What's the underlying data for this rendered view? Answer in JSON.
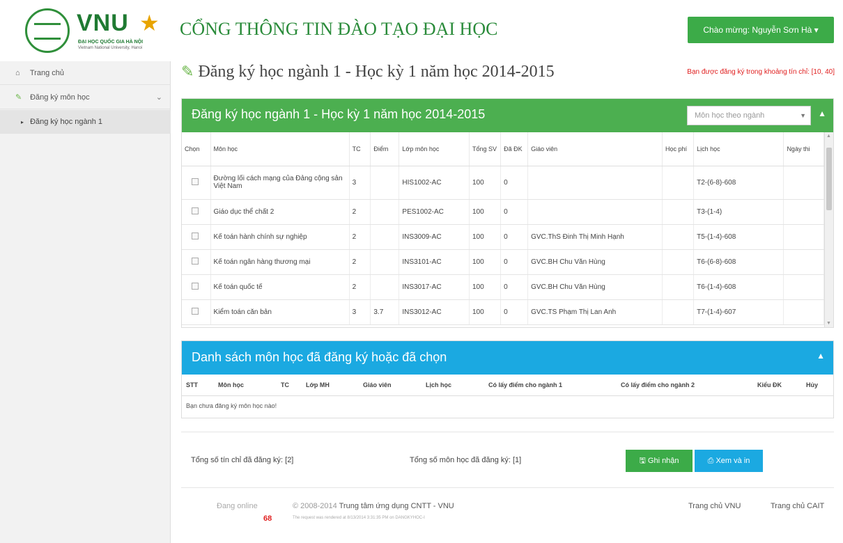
{
  "header": {
    "logo_text": "VNU",
    "logo_sub1": "ĐẠI HỌC QUỐC GIA HÀ NỘI",
    "logo_sub2": "Vietnam National University, Hanoi",
    "site_title": "CỔNG THÔNG TIN ĐÀO TẠO ĐẠI HỌC",
    "user_menu": "Chào mừng: Nguyễn Sơn Hà ▾"
  },
  "sidebar": {
    "items": [
      {
        "label": "Trang chủ",
        "icon": "home-icon"
      },
      {
        "label": "Đăng ký môn học",
        "icon": "edit-icon"
      },
      {
        "label": "Đăng ký học ngành 1",
        "icon": "caret-right-icon"
      }
    ]
  },
  "page": {
    "title": "Đăng ký học ngành 1 - Học kỳ 1 năm học 2014-2015",
    "credit_note": "Bạn được đăng ký trong khoảng tín chỉ: [10, 40]"
  },
  "panel1": {
    "title": "Đăng ký học ngành 1 - Học kỳ 1 năm học 2014-2015",
    "filter_select": "Môn học theo ngành",
    "columns": [
      "Chọn",
      "Môn học",
      "TC",
      "Điểm",
      "Lớp môn học",
      "Tổng SV",
      "Đã ĐK",
      "Giáo viên",
      "Học phí",
      "Lịch học",
      "Ngày thi"
    ],
    "rows": [
      [
        "",
        "Đường lối cách mạng của Đảng cộng sản Việt Nam",
        "3",
        "",
        "HIS1002-AC",
        "100",
        "0",
        "",
        "",
        "T2-(6-8)-608",
        ""
      ],
      [
        "",
        "Giáo dục thể chất 2",
        "2",
        "",
        "PES1002-AC",
        "100",
        "0",
        "",
        "",
        "T3-(1-4)",
        ""
      ],
      [
        "",
        "Kế toán hành chính sự nghiệp",
        "2",
        "",
        "INS3009-AC",
        "100",
        "0",
        "GVC.ThS Đinh Thị Minh Hạnh",
        "",
        "T5-(1-4)-608",
        ""
      ],
      [
        "",
        "Kế toán ngân hàng thương mại",
        "2",
        "",
        "INS3101-AC",
        "100",
        "0",
        "GVC.BH Chu Văn Hùng",
        "",
        "T6-(6-8)-608",
        ""
      ],
      [
        "",
        "Kế toán quốc tế",
        "2",
        "",
        "INS3017-AC",
        "100",
        "0",
        "GVC.BH Chu Văn Hùng",
        "",
        "T6-(1-4)-608",
        ""
      ],
      [
        "",
        "Kiểm toán căn bản",
        "3",
        "3.7",
        "INS3012-AC",
        "100",
        "0",
        "GVC.TS Phạm Thị Lan Anh",
        "",
        "T7-(1-4)-607",
        ""
      ]
    ]
  },
  "panel2": {
    "title": "Danh sách môn học đã đăng ký hoặc đã chọn",
    "columns": [
      "STT",
      "Môn học",
      "TC",
      "Lớp MH",
      "Giáo viên",
      "Lịch học",
      "Có lấy điểm cho ngành 1",
      "Có lấy điểm cho ngành 2",
      "Kiểu ĐK",
      "Hủy"
    ],
    "empty_text": "Bạn chưa đăng ký môn học nào!"
  },
  "totals": {
    "credits": "Tổng số tín chỉ đã đăng ký: [2]",
    "courses": "Tổng số môn học đã đăng ký: [1]",
    "confirm_button": "Ghi nhận",
    "print_button": "Xem và in"
  },
  "footer": {
    "online_label": "Đang online",
    "online_count": "68",
    "copyright_prefix": "© 2008-2014",
    "copyright_org": "Trung tâm ứng dụng CNTT - VNU",
    "rendered_note": "The request was rendered at 8/13/2014 3:31:35 PM on DANGKYHOC-I",
    "link_vnu": "Trang chủ VNU",
    "link_cait": "Trang chủ CAIT"
  },
  "colors": {
    "green": "#4caf50",
    "blue": "#1ba9e1",
    "red_note": "#e02020"
  }
}
